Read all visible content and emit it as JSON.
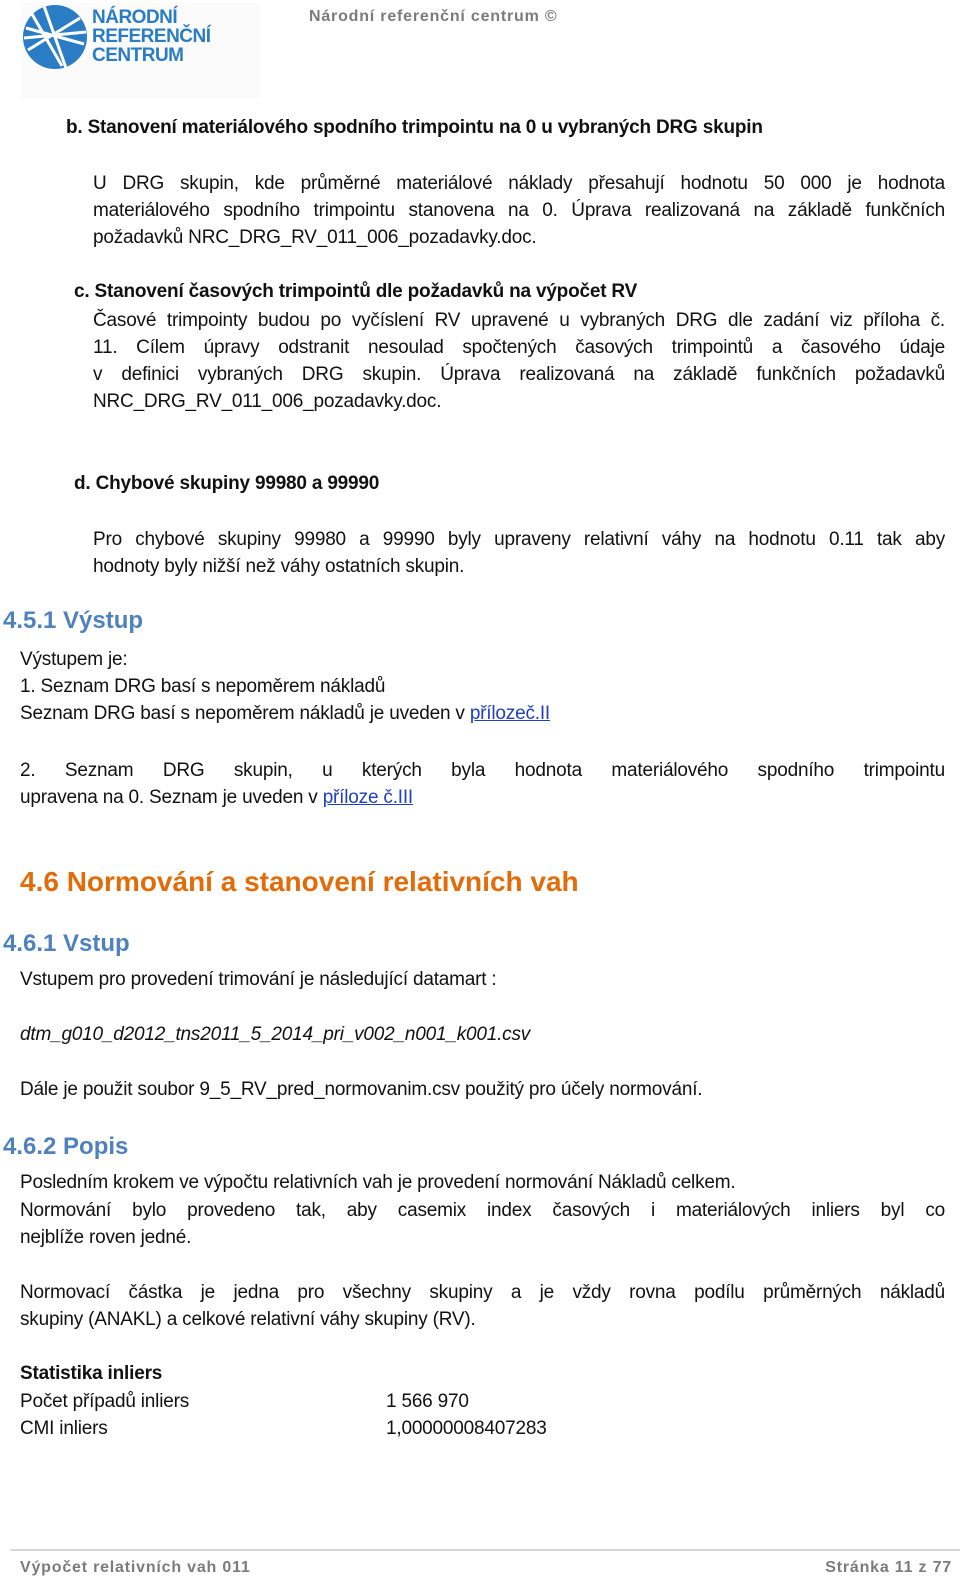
{
  "header": {
    "logo": {
      "line1": "NÁRODNÍ",
      "line2": "REFERENČNÍ",
      "line3": "CENTRUM",
      "color": "#2a7dc4"
    },
    "title": "Národní referenční centrum ©"
  },
  "section_b": {
    "heading": "b. Stanovení materiálového spodního trimpointu na 0 u vybraných DRG skupin",
    "lines": [
      "U DRG skupin, kde průměrné materiálové náklady přesahují hodnotu 50 000 je hodnota",
      "materiálového spodního trimpointu stanovena na 0. Úprava realizovaná na základě funkčních",
      "požadavků NRC_DRG_RV_011_006_pozadavky.doc."
    ]
  },
  "section_c": {
    "heading": "c. Stanovení časových trimpointů dle požadavků na výpočet RV",
    "lines": [
      "Časové trimpointy budou po vyčíslení RV upravené u vybraných DRG dle zadání viz příloha č.",
      "11. Cílem úpravy odstranit nesoulad spočtených časových trimpointů a časového údaje",
      "v definici vybraných DRG skupin. Úprava realizovaná na základě funkčních požadavků",
      "NRC_DRG_RV_011_006_pozadavky.doc."
    ]
  },
  "section_d": {
    "heading": "d. Chybové skupiny 99980 a 99990",
    "lines": [
      "Pro chybové skupiny 99980 a 99990 byly upraveny relativní váhy na hodnotu 0.11 tak aby",
      "hodnoty byly nižší než váhy ostatních skupin."
    ]
  },
  "section_451": {
    "heading": "4.5.1  Výstup",
    "intro": "Výstupem je:",
    "item1_title": "1. Seznam DRG basí s nepoměrem nákladů",
    "item1_text": "Seznam DRG basí s nepoměrem nákladů je uveden v ",
    "item1_link": "přílozeč.II",
    "item2_line1": "2. Seznam DRG skupin, u kterých byla hodnota materiálového spodního trimpointu",
    "item2_line2_text": "upravena na 0. Seznam je uveden v ",
    "item2_link": "příloze č.III"
  },
  "section_46": {
    "heading": "4.6  Normování a stanovení relativních vah",
    "color": "#e36c0a"
  },
  "section_461": {
    "heading": "4.6.1  Vstup",
    "intro": "Vstupem pro provedení trimování  je následující datamart :",
    "datamart": "dtm_g010_d2012_tns2011_5_2014_pri_v002_n001_k001.csv",
    "note": "Dále je použit soubor 9_5_RV_pred_normovanim.csv použitý pro účely normování."
  },
  "section_462": {
    "heading": "4.6.2  Popis",
    "p1": "Posledním krokem ve výpočtu relativních vah je provedení normování Nákladů celkem.",
    "p2_lines": [
      "Normování bylo provedeno tak, aby casemix index časových i materiálových inliers byl co",
      "nejblíže roven jedné."
    ],
    "p3_lines": [
      "Normovací částka je jedna pro všechny skupiny a je vždy rovna podílu průměrných nákladů",
      "skupiny (ANAKL)  a celkové relativní váhy skupiny (RV)."
    ]
  },
  "statistics": {
    "heading": "Statistika  inliers",
    "rows": [
      {
        "label": "Počet případů  inliers",
        "value": "1 566 970"
      },
      {
        "label": "CMI inliers",
        "value": "1,00000008407283"
      }
    ]
  },
  "footer": {
    "left": "Výpočet relativních vah 011",
    "right": "Stránka 11 z 77"
  },
  "colors": {
    "heading_blue": "#4f81bd",
    "heading_orange": "#e36c0a",
    "link": "#1f3fbf",
    "footer_gray": "#7b7b7b"
  }
}
